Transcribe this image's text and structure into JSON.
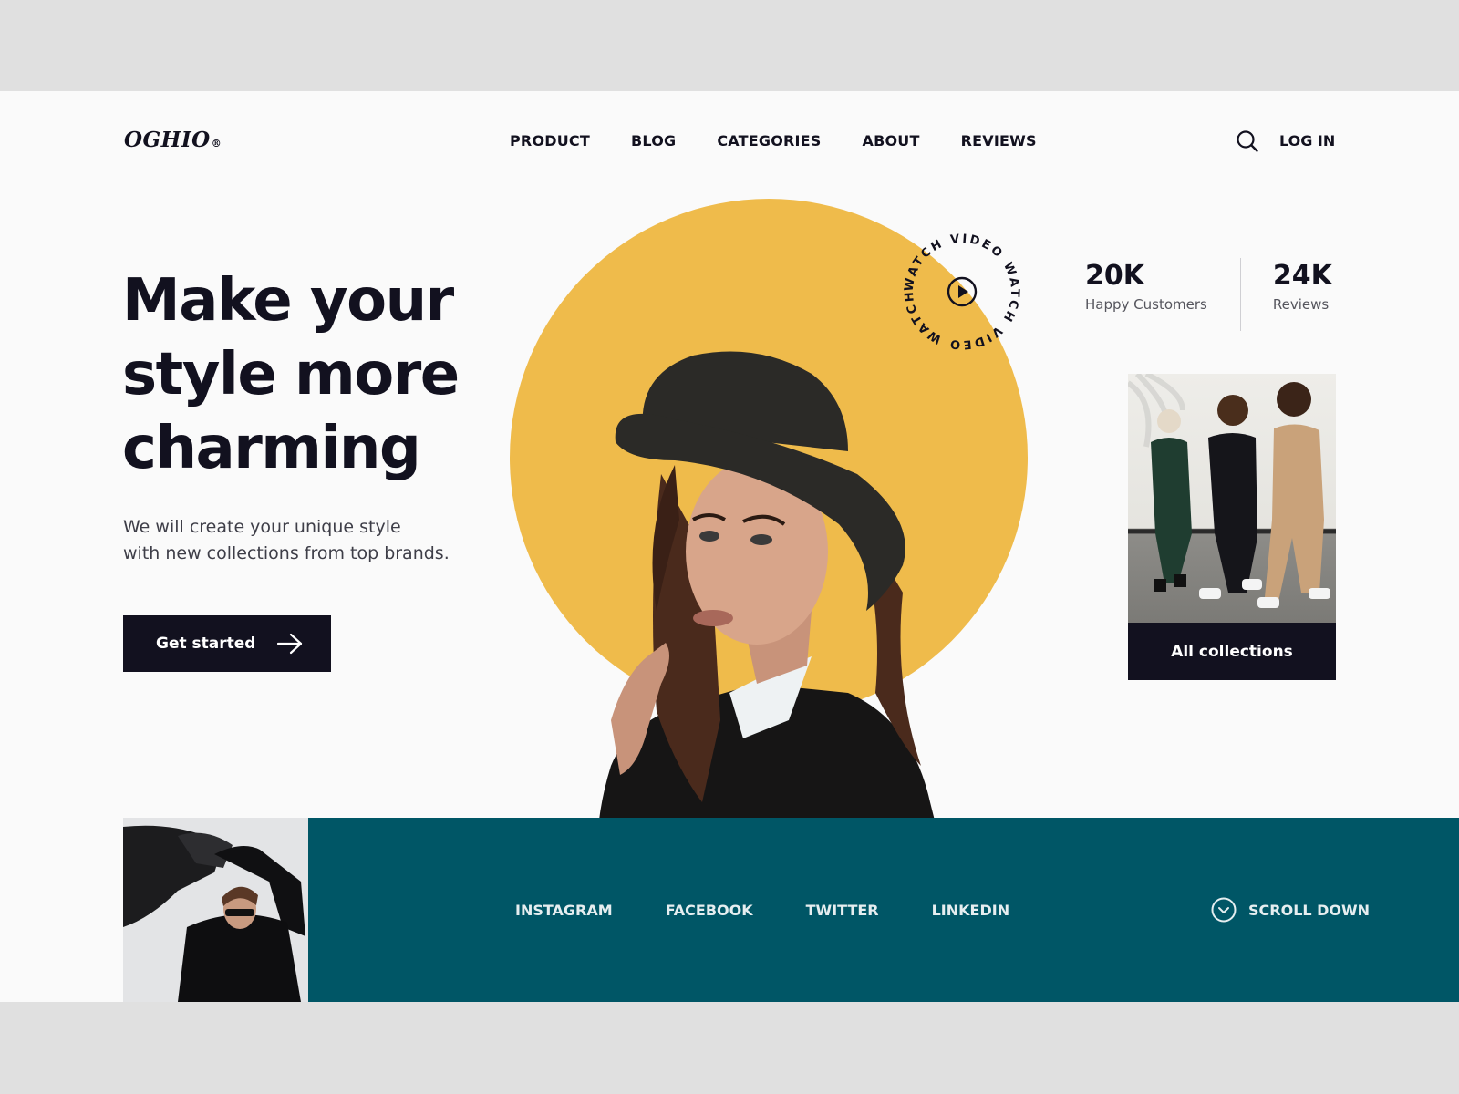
{
  "brand": {
    "name": "OGHIO",
    "registered_mark": "®"
  },
  "nav": {
    "items": [
      {
        "label": "PRODUCT"
      },
      {
        "label": "BLOG"
      },
      {
        "label": "CATEGORIES"
      },
      {
        "label": "ABOUT"
      },
      {
        "label": "REVIEWS"
      }
    ],
    "search_icon": "search-icon",
    "login_label": "LOG IN"
  },
  "hero": {
    "headline_lines": [
      "Make your",
      "style more",
      "charming"
    ],
    "subtitle_lines": [
      "We will create your unique style",
      "with new collections from top brands."
    ],
    "cta_label": "Get started",
    "cta_icon": "arrow-right-icon",
    "watch_video_text": "WATCH VIDEO WATCH VIDEO WATCH VIDEO",
    "play_icon": "play-icon"
  },
  "stats": [
    {
      "value": "20K",
      "label": "Happy Customers"
    },
    {
      "value": "24K",
      "label": "Reviews"
    }
  ],
  "collection": {
    "button_label": "All collections"
  },
  "footer_band": {
    "social": [
      {
        "label": "INSTAGRAM"
      },
      {
        "label": "FACEBOOK"
      },
      {
        "label": "TWITTER"
      },
      {
        "label": "LINKEDIN"
      }
    ],
    "scroll_label": "SCROLL DOWN",
    "scroll_icon": "chevron-down-circle-icon"
  },
  "colors": {
    "ink": "#12111f",
    "accent_yellow": "#efbb4b",
    "teal": "#005666",
    "page_bg": "#fafafa",
    "outer_bg": "#e0e0e0"
  }
}
